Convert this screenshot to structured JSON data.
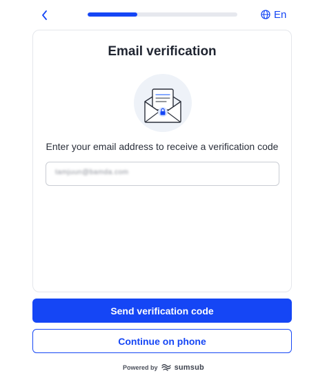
{
  "header": {
    "progress_fraction": 0.33,
    "language_label": "En"
  },
  "card": {
    "title": "Email verification",
    "instruction": "Enter your email address to receive a verification code",
    "email_value": "tamjuun@bamda.com"
  },
  "actions": {
    "send_label": "Send verification code",
    "phone_label": "Continue on phone"
  },
  "footer": {
    "powered_by": "Powered by",
    "brand": "sumsub"
  },
  "colors": {
    "accent": "#1546f5",
    "illustration_bg": "#eef2f8"
  }
}
